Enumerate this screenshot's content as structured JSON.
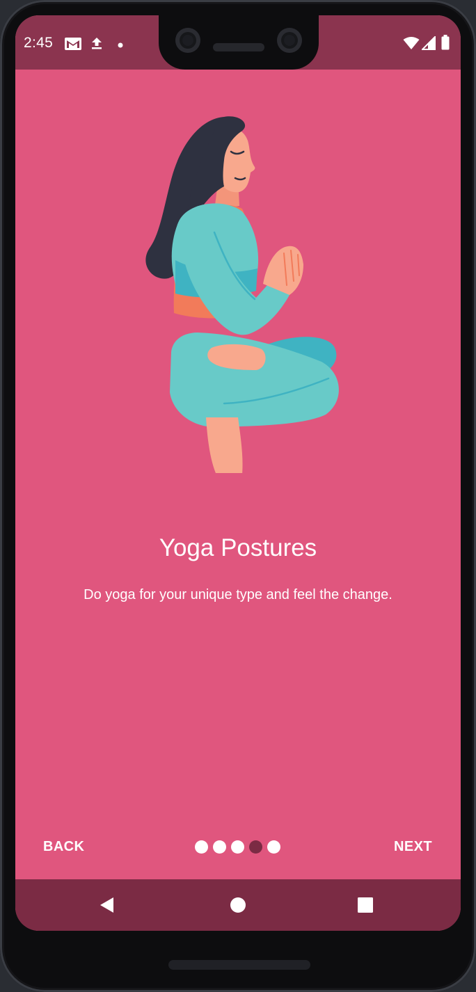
{
  "status_bar": {
    "time": "2:45",
    "icons": [
      "gmail-icon",
      "upload-icon",
      "notification-dot-icon",
      "wifi-icon",
      "signal-icon",
      "battery-icon"
    ]
  },
  "onboarding": {
    "illustration": "woman-yoga-lotus-pose-illustration",
    "title": "Yoga Postures",
    "subtitle": "Do yoga for your unique type and feel the change.",
    "back_label": "BACK",
    "next_label": "NEXT",
    "page_count": 5,
    "current_page": 4
  },
  "system_nav": {
    "icons": [
      "back-triangle-icon",
      "home-circle-icon",
      "recents-square-icon"
    ]
  },
  "colors": {
    "background": "#e0567e",
    "status_bar": "#8b344f",
    "nav_bar": "#7b2b44",
    "active_dot": "#7b2b44",
    "text": "#ffffff"
  }
}
